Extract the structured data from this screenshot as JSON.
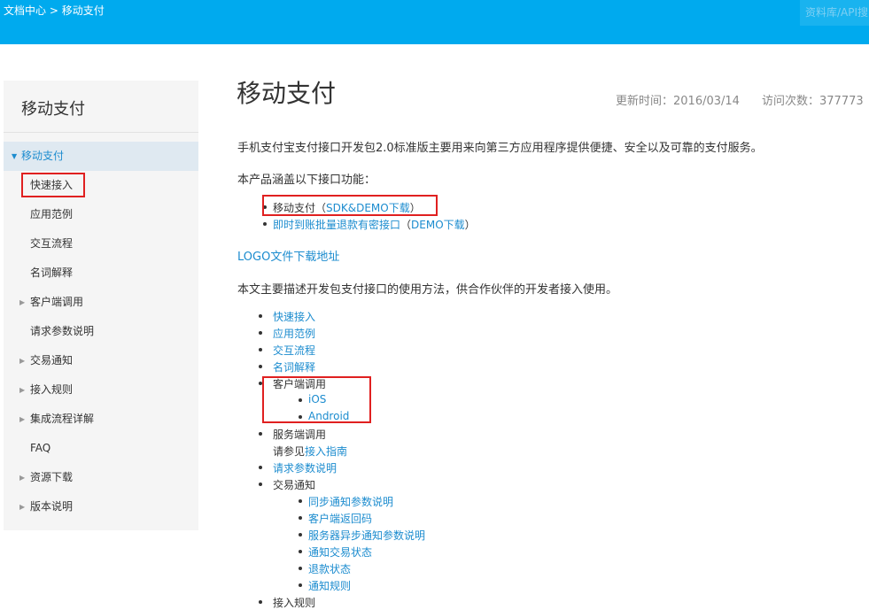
{
  "header": {
    "breadcrumb_root": "文档中心",
    "breadcrumb_sep": ">",
    "breadcrumb_current": "移动支付",
    "search_placeholder": "资料库/API搜"
  },
  "sidebar": {
    "title": "移动支付",
    "items": [
      {
        "label": "移动支付",
        "caret": "▼"
      },
      {
        "label": "快速接入"
      },
      {
        "label": "应用范例"
      },
      {
        "label": "交互流程"
      },
      {
        "label": "名词解释"
      },
      {
        "label": "客户端调用",
        "caret": "▶"
      },
      {
        "label": "请求参数说明"
      },
      {
        "label": "交易通知",
        "caret": "▶"
      },
      {
        "label": "接入规则",
        "caret": "▶"
      },
      {
        "label": "集成流程详解",
        "caret": "▶"
      },
      {
        "label": "FAQ"
      },
      {
        "label": "资源下载",
        "caret": "▶"
      },
      {
        "label": "版本说明",
        "caret": "▶"
      }
    ]
  },
  "main": {
    "title": "移动支付",
    "updated": "更新时间：2016/03/14",
    "visits": "访问次数：377773",
    "intro": "手机支付宝支付接口开发包2.0标准版主要用来向第三方应用程序提供便捷、安全以及可靠的支付服务。",
    "covers": "本产品涵盖以下接口功能：",
    "features": {
      "f1_text": "移动支付（",
      "f1_link": "SDK&DEMO下载",
      "f1_close": "）",
      "f2_link": "即时到账批量退款有密接口",
      "f2_open": "（",
      "f2_link2": "DEMO下载",
      "f2_close": "）"
    },
    "logo_link": "LOGO文件下载地址",
    "desc": "本文主要描述开发包支付接口的使用方法，供合作伙伴的开发者接入使用。",
    "toc": {
      "quick": "快速接入",
      "example": "应用范例",
      "flow": "交互流程",
      "terms": "名词解释",
      "client": "客户端调用",
      "ios": "iOS",
      "android": "Android",
      "server": "服务端调用",
      "server_note": "请参见",
      "server_link": "接入指南",
      "params": "请求参数说明",
      "notify": "交易通知",
      "n1": "同步通知参数说明",
      "n2": "客户端返回码",
      "n3": "服务器异步通知参数说明",
      "n4": "通知交易状态",
      "n5": "退款状态",
      "n6": "通知规则",
      "rules": "接入规则"
    }
  }
}
